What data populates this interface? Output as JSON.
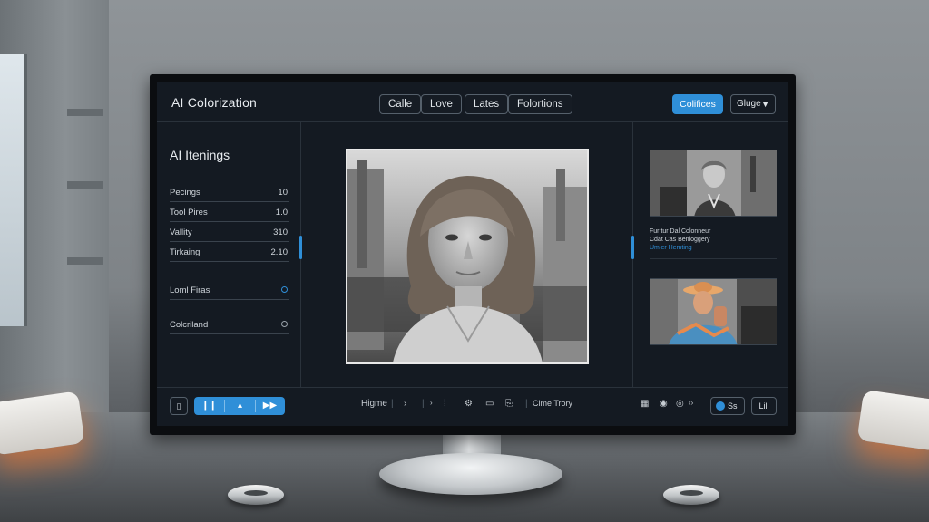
{
  "app": {
    "title": "AI Colorization"
  },
  "header": {
    "tabs": [
      {
        "label": "Calle"
      },
      {
        "label": "Love"
      },
      {
        "label": "Lates"
      },
      {
        "label": "Folortions"
      }
    ],
    "primary_button": "Colifices",
    "dropdown_value": "Gluge"
  },
  "sidebar": {
    "heading": "AI Itenings",
    "settings": [
      {
        "label": "Pecings",
        "value": "10"
      },
      {
        "label": "Tool Pires",
        "value": "1.0"
      },
      {
        "label": "Vallity",
        "value": "310"
      },
      {
        "label": "Tirkaing",
        "value": "2.10"
      }
    ],
    "toggles": [
      {
        "label": "Loml Firas"
      },
      {
        "label": "Colcriland"
      }
    ]
  },
  "preview": {
    "meta_lines": [
      "Fur tur Dal Colonneur",
      "Cdat Cas Benloggery",
      "Umler Hemting"
    ]
  },
  "bottom_bar": {
    "blue_buttons": [
      {
        "icon": "pause-icon",
        "glyph": "❙❙"
      },
      {
        "icon": "user-icon",
        "glyph": "▴"
      },
      {
        "icon": "fast-forward-icon",
        "glyph": "▶▶"
      }
    ],
    "mode_label": "Higme",
    "status_label": "Cime Trory",
    "toggle_label": "Ssi",
    "end_label": "Lill"
  },
  "colors": {
    "accent": "#2f8fd8",
    "screen_bg": "#141a22",
    "border": "#2a323b"
  }
}
